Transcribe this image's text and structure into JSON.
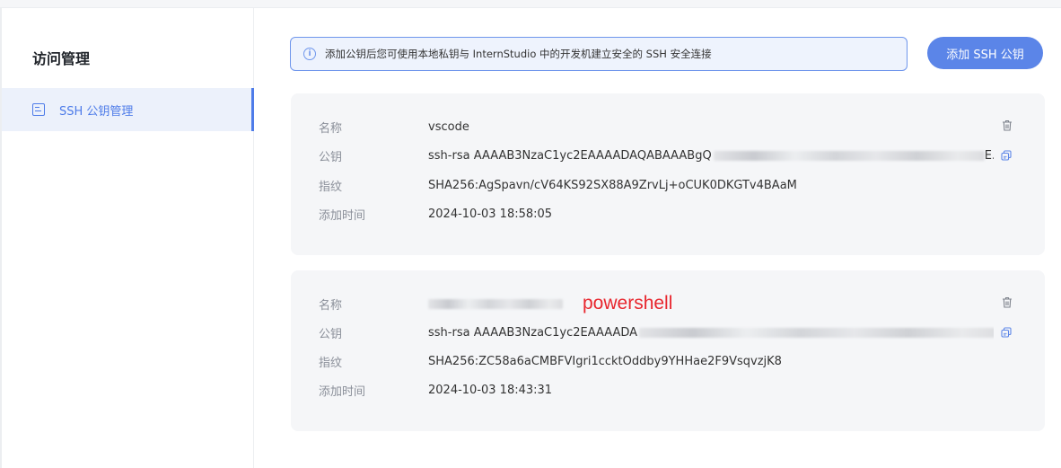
{
  "sidebar": {
    "title": "访问管理",
    "items": [
      {
        "label": "SSH 公钥管理",
        "icon": "document-icon",
        "active": true
      }
    ]
  },
  "notice": {
    "icon": "info-icon",
    "text": "添加公钥后您可使用本地私钥与 InternStudio 中的开发机建立安全的 SSH 安全连接"
  },
  "toolbar": {
    "add_label": "添加 SSH 公钥"
  },
  "labels": {
    "name": "名称",
    "key": "公钥",
    "fingerprint": "指纹",
    "added_at": "添加时间"
  },
  "keys": [
    {
      "name": "vscode",
      "key_prefix": "ssh-rsa AAAAB3NzaC1yc2EAAAADAQABAAABgQ",
      "key_suffix": "E...",
      "fingerprint": "SHA256:AgSpavn/cV64KS92SX88A9ZrvLj+oCUK0DKGTv4BAaM",
      "added_at": "2024-10-03 18:58:05"
    },
    {
      "name": "",
      "annotation": "powershell",
      "key_prefix": "ssh-rsa AAAAB3NzaC1yc2EAAAADA",
      "key_suffix": "..",
      "fingerprint": "SHA256:ZC58a6aCMBFVIgri1ccktOddby9YHHae2F9VsqvzjK8",
      "added_at": "2024-10-03 18:43:31"
    }
  ],
  "colors": {
    "accent": "#5b85e8",
    "annotation": "#e8262e",
    "card_bg": "#f5f6f8"
  }
}
